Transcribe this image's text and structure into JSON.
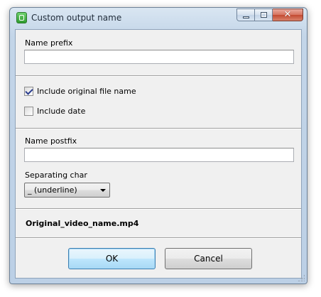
{
  "window": {
    "title": "Custom output name"
  },
  "fields": {
    "prefix_label": "Name prefix",
    "prefix_value": "",
    "postfix_label": "Name postfix",
    "postfix_value": ""
  },
  "options": {
    "include_original_label": "Include original file name",
    "include_original_checked": true,
    "include_date_label": "Include date",
    "include_date_checked": false
  },
  "separator": {
    "label": "Separating char",
    "selected": "_ (underline)"
  },
  "preview": {
    "filename": "Original_video_name.mp4"
  },
  "buttons": {
    "ok": "OK",
    "cancel": "Cancel"
  },
  "icons": {
    "app": "app-icon",
    "minimize": "minimize-icon",
    "maximize": "maximize-icon",
    "close": "close-icon",
    "dropdown": "chevron-down-icon",
    "check": "check-icon"
  }
}
